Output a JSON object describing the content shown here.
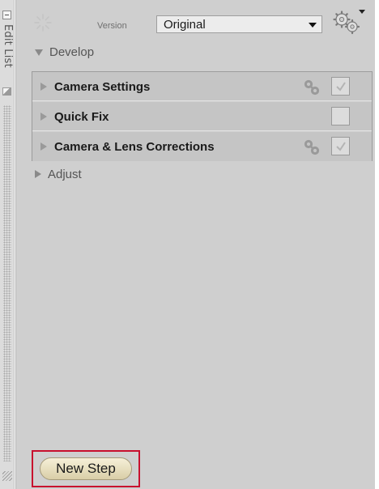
{
  "sidebar": {
    "tab_label": "Edit List",
    "collapse_icon": "collapse-icon",
    "thumb_icon": "image-thumbnail-icon"
  },
  "toolbar": {
    "spinner_icon": "spinner-icon",
    "version_label": "Version",
    "version_value": "Original",
    "gear_icon": "gears-icon"
  },
  "groups": {
    "develop": {
      "label": "Develop",
      "expanded": true
    },
    "adjust": {
      "label": "Adjust",
      "expanded": false
    }
  },
  "steps": [
    {
      "label": "Camera Settings",
      "linked": true,
      "checked": true
    },
    {
      "label": "Quick Fix",
      "linked": false,
      "checked": false
    },
    {
      "label": "Camera & Lens Corrections",
      "linked": true,
      "checked": true
    }
  ],
  "footer": {
    "new_step_label": "New Step"
  },
  "colors": {
    "panel_bg": "#cfcfcf",
    "row_bg": "#c5c5c5",
    "highlight_border": "#c8102e",
    "button_bg": "#e8dfbe"
  }
}
